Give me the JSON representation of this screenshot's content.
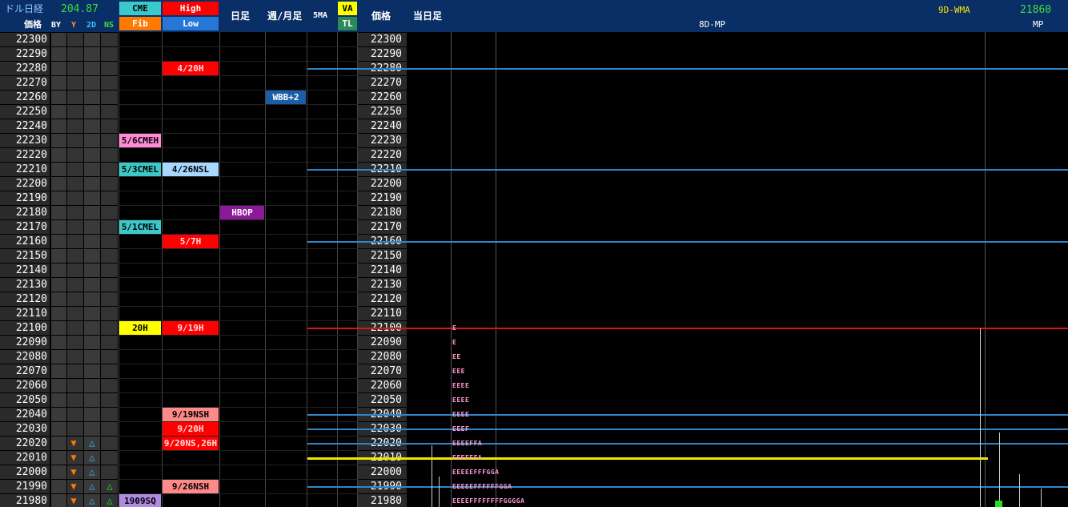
{
  "header": {
    "title": "ドル日経",
    "price_label": "価格",
    "top_value": "204.87",
    "col_by": "BY",
    "col_y": "Y",
    "col_2d": "2D",
    "col_ns": "NS",
    "cme": "CME",
    "fib": "Fib",
    "high": "High",
    "low": "Low",
    "daily": "日足",
    "weekly_monthly": "週/月足",
    "ma5": "5MA",
    "va": "VA",
    "tl": "TL",
    "price_label2": "価格",
    "today": "当日足",
    "mp8d": "8D-MP",
    "wma9d": "9D-WMA",
    "wma_value": "21860",
    "mp": "MP"
  },
  "prices": [
    "22300",
    "22290",
    "22280",
    "22270",
    "22260",
    "22250",
    "22240",
    "22230",
    "22220",
    "22210",
    "22200",
    "22190",
    "22180",
    "22170",
    "22160",
    "22150",
    "22140",
    "22130",
    "22120",
    "22110",
    "22100",
    "22090",
    "22080",
    "22070",
    "22060",
    "22050",
    "22040",
    "22030",
    "22020",
    "22010",
    "22000",
    "21990",
    "21980"
  ],
  "tags": [
    {
      "row": 2,
      "col": "high",
      "text": "4/20H",
      "bg": "#ff0000",
      "fg": "#ffe0e0"
    },
    {
      "row": 4,
      "col": "weekly",
      "text": "WBB+2",
      "bg": "#1b5ea8",
      "fg": "#ffffff"
    },
    {
      "row": 7,
      "col": "cme",
      "text": "5/6CMEH",
      "bg": "#ff8ad8",
      "fg": "#000000"
    },
    {
      "row": 9,
      "col": "cme",
      "text": "5/3CMEL",
      "bg": "#3cc8c8",
      "fg": "#000000"
    },
    {
      "row": 9,
      "col": "high",
      "text": "4/26NSL",
      "bg": "#a8d8ff",
      "fg": "#000000"
    },
    {
      "row": 12,
      "col": "daily",
      "text": "HBOP",
      "bg": "#8a1a9a",
      "fg": "#ffffff"
    },
    {
      "row": 13,
      "col": "cme",
      "text": "5/1CMEL",
      "bg": "#3cc8c8",
      "fg": "#000000"
    },
    {
      "row": 14,
      "col": "high",
      "text": "5/7H",
      "bg": "#ff0000",
      "fg": "#ffe0e0"
    },
    {
      "row": 20,
      "col": "cme",
      "text": "20H",
      "bg": "#ffff00",
      "fg": "#000000"
    },
    {
      "row": 20,
      "col": "high",
      "text": "9/19H",
      "bg": "#ff0000",
      "fg": "#ffe0e0"
    },
    {
      "row": 26,
      "col": "high",
      "text": "9/19NSH",
      "bg": "#ff8888",
      "fg": "#000000"
    },
    {
      "row": 27,
      "col": "high",
      "text": "9/20H",
      "bg": "#ff0000",
      "fg": "#ffe0e0"
    },
    {
      "row": 28,
      "col": "high",
      "text": "9/20NS,26H",
      "bg": "#ff0000",
      "fg": "#ffe0e0"
    },
    {
      "row": 31,
      "col": "high",
      "text": "9/26NSH",
      "bg": "#ff8888",
      "fg": "#000000"
    },
    {
      "row": 32,
      "col": "cme",
      "text": "1909SQ",
      "bg": "#b08ae0",
      "fg": "#000000"
    }
  ],
  "tpo": [
    {
      "row": 20,
      "text": "E"
    },
    {
      "row": 21,
      "text": "E"
    },
    {
      "row": 22,
      "text": "EE"
    },
    {
      "row": 23,
      "text": "EEE"
    },
    {
      "row": 24,
      "text": "EEEE"
    },
    {
      "row": 25,
      "text": "EEEE"
    },
    {
      "row": 26,
      "text": "EEEE"
    },
    {
      "row": 27,
      "text": "EEEF"
    },
    {
      "row": 28,
      "text": "EEEEFFA"
    },
    {
      "row": 29,
      "text": "EEEEFFA"
    },
    {
      "row": 30,
      "text": "EEEEEFFFGGA"
    },
    {
      "row": 31,
      "text": "EEEEEFFFFFFGGA"
    },
    {
      "row": 32,
      "text": "EEEEFFFFFFFFGGGGA"
    }
  ],
  "triangles": [
    {
      "row": 28,
      "by": "▼",
      "y2d": "△",
      "ns": ""
    },
    {
      "row": 29,
      "by": "▼",
      "y2d": "△",
      "ns": ""
    },
    {
      "row": 30,
      "by": "▼",
      "y2d": "△",
      "ns": ""
    },
    {
      "row": 31,
      "by": "▼",
      "y2d": "△",
      "ns": "△"
    },
    {
      "row": 32,
      "by": "▼",
      "y2d": "△",
      "ns": "△"
    }
  ],
  "colors": {
    "header_bg": "#0a2e66",
    "level_blue": "#2e86c8",
    "level_red": "#d01818",
    "level_yellow": "#e8e800",
    "tri_orange": "#ff7a00",
    "tri_cyan": "#29c4e8",
    "tri_green": "#22e022"
  }
}
